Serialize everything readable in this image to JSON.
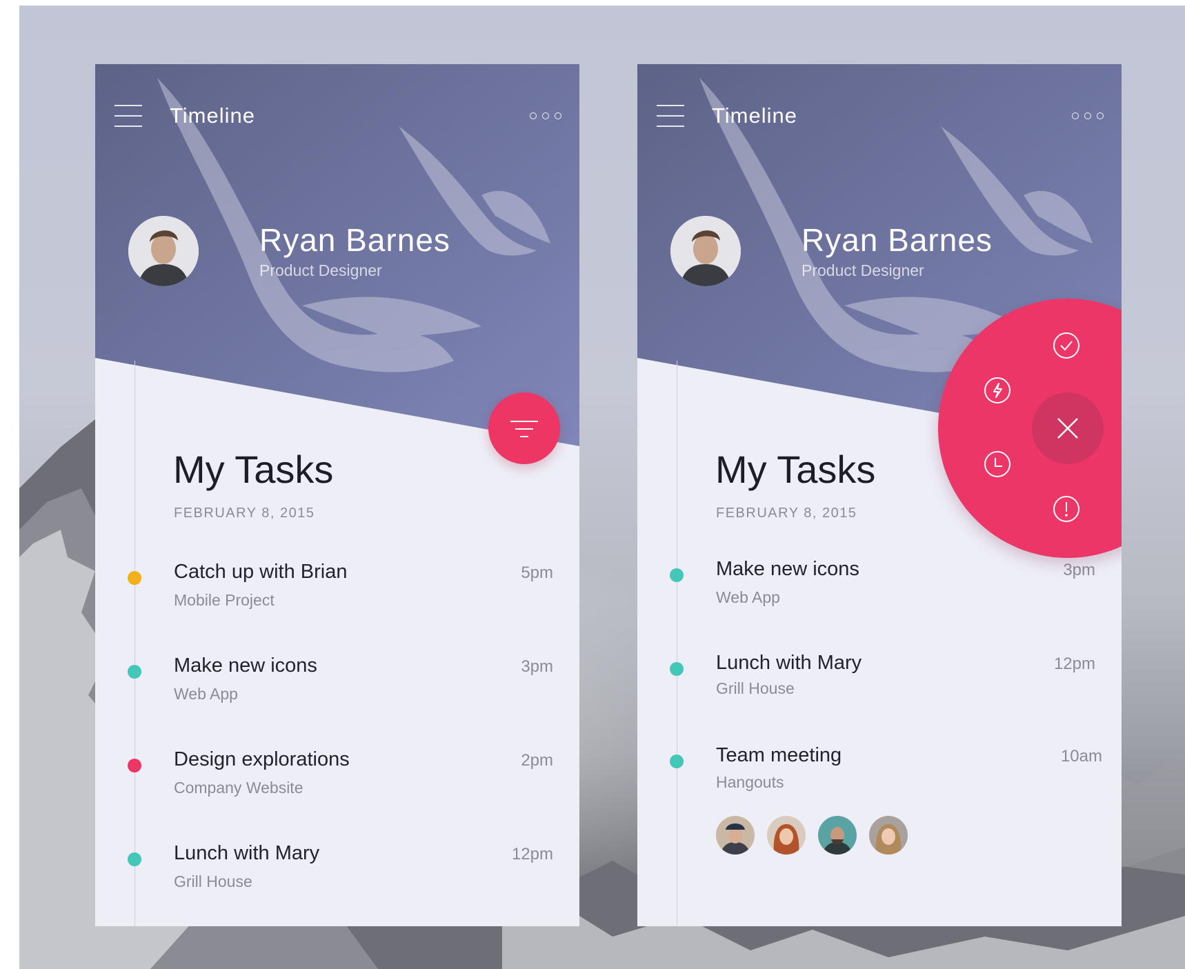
{
  "screens": [
    {
      "header": {
        "title": "Timeline"
      },
      "profile": {
        "name": "Ryan Barnes",
        "role": "Product Designer"
      },
      "section": {
        "title": "My Tasks",
        "date": "FEBRUARY 8, 2015"
      },
      "tasks": [
        {
          "title": "Catch up with Brian",
          "subtitle": "Mobile Project",
          "time": "5pm",
          "dot_color": "#f2b11a"
        },
        {
          "title": "Make new icons",
          "subtitle": "Web App",
          "time": "3pm",
          "dot_color": "#42c7b9"
        },
        {
          "title": "Design explorations",
          "subtitle": "Company Website",
          "time": "2pm",
          "dot_color": "#ee3665"
        },
        {
          "title": "Lunch with Mary",
          "subtitle": "Grill House",
          "time": "12pm",
          "dot_color": "#42c7b9"
        }
      ],
      "fab": {
        "icon": "filter-icon"
      }
    },
    {
      "header": {
        "title": "Timeline"
      },
      "profile": {
        "name": "Ryan Barnes",
        "role": "Product Designer"
      },
      "section": {
        "title": "My Tasks",
        "date": "FEBRUARY 8, 2015"
      },
      "tasks": [
        {
          "title": "Make new icons",
          "subtitle": "Web App",
          "time": "3pm",
          "dot_color": "#42c7b9"
        },
        {
          "title": "Lunch with Mary",
          "subtitle": "Grill House",
          "time": "12pm",
          "dot_color": "#42c7b9"
        },
        {
          "title": "Team meeting",
          "subtitle": "Hangouts",
          "time": "10am",
          "dot_color": "#42c7b9"
        }
      ],
      "attendees": [
        "attendee-avatar",
        "attendee-avatar",
        "attendee-avatar",
        "attendee-avatar"
      ],
      "radial_menu": {
        "items": [
          "check-icon",
          "bolt-icon",
          "clock-icon",
          "alert-icon"
        ],
        "close_icon": "close-icon"
      }
    }
  ],
  "colors": {
    "accent": "#ee3665",
    "teal": "#42c7b9",
    "yellow": "#f2b11a",
    "panel_bg": "#eeeef6",
    "header_tint": "#7c80b0"
  }
}
